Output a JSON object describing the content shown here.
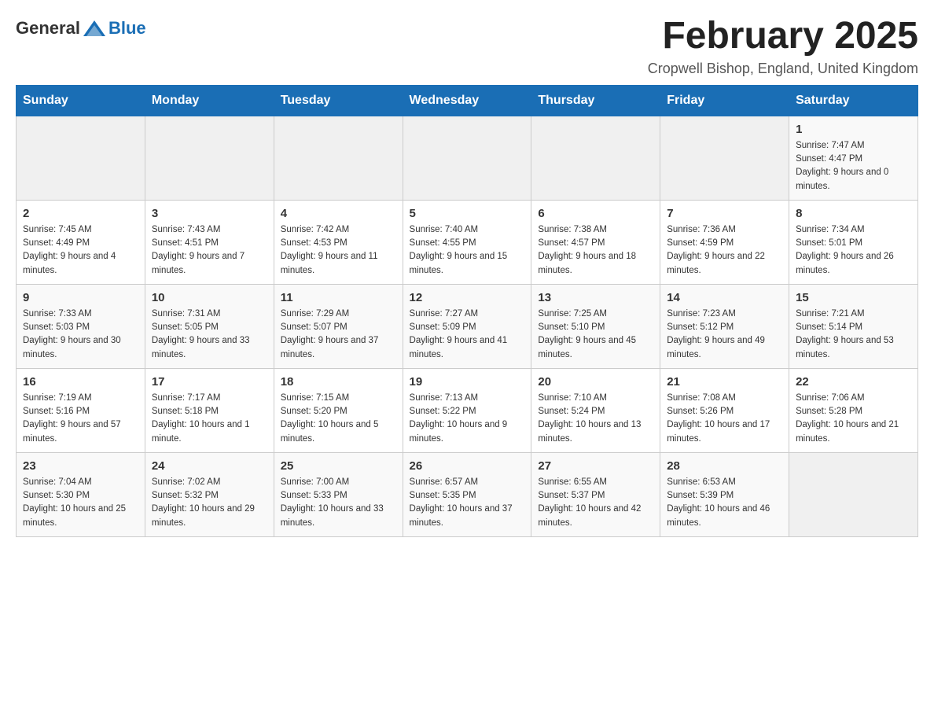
{
  "logo": {
    "general": "General",
    "blue": "Blue"
  },
  "title": "February 2025",
  "location": "Cropwell Bishop, England, United Kingdom",
  "days_header": [
    "Sunday",
    "Monday",
    "Tuesday",
    "Wednesday",
    "Thursday",
    "Friday",
    "Saturday"
  ],
  "weeks": [
    [
      {
        "day": "",
        "info": ""
      },
      {
        "day": "",
        "info": ""
      },
      {
        "day": "",
        "info": ""
      },
      {
        "day": "",
        "info": ""
      },
      {
        "day": "",
        "info": ""
      },
      {
        "day": "",
        "info": ""
      },
      {
        "day": "1",
        "info": "Sunrise: 7:47 AM\nSunset: 4:47 PM\nDaylight: 9 hours and 0 minutes."
      }
    ],
    [
      {
        "day": "2",
        "info": "Sunrise: 7:45 AM\nSunset: 4:49 PM\nDaylight: 9 hours and 4 minutes."
      },
      {
        "day": "3",
        "info": "Sunrise: 7:43 AM\nSunset: 4:51 PM\nDaylight: 9 hours and 7 minutes."
      },
      {
        "day": "4",
        "info": "Sunrise: 7:42 AM\nSunset: 4:53 PM\nDaylight: 9 hours and 11 minutes."
      },
      {
        "day": "5",
        "info": "Sunrise: 7:40 AM\nSunset: 4:55 PM\nDaylight: 9 hours and 15 minutes."
      },
      {
        "day": "6",
        "info": "Sunrise: 7:38 AM\nSunset: 4:57 PM\nDaylight: 9 hours and 18 minutes."
      },
      {
        "day": "7",
        "info": "Sunrise: 7:36 AM\nSunset: 4:59 PM\nDaylight: 9 hours and 22 minutes."
      },
      {
        "day": "8",
        "info": "Sunrise: 7:34 AM\nSunset: 5:01 PM\nDaylight: 9 hours and 26 minutes."
      }
    ],
    [
      {
        "day": "9",
        "info": "Sunrise: 7:33 AM\nSunset: 5:03 PM\nDaylight: 9 hours and 30 minutes."
      },
      {
        "day": "10",
        "info": "Sunrise: 7:31 AM\nSunset: 5:05 PM\nDaylight: 9 hours and 33 minutes."
      },
      {
        "day": "11",
        "info": "Sunrise: 7:29 AM\nSunset: 5:07 PM\nDaylight: 9 hours and 37 minutes."
      },
      {
        "day": "12",
        "info": "Sunrise: 7:27 AM\nSunset: 5:09 PM\nDaylight: 9 hours and 41 minutes."
      },
      {
        "day": "13",
        "info": "Sunrise: 7:25 AM\nSunset: 5:10 PM\nDaylight: 9 hours and 45 minutes."
      },
      {
        "day": "14",
        "info": "Sunrise: 7:23 AM\nSunset: 5:12 PM\nDaylight: 9 hours and 49 minutes."
      },
      {
        "day": "15",
        "info": "Sunrise: 7:21 AM\nSunset: 5:14 PM\nDaylight: 9 hours and 53 minutes."
      }
    ],
    [
      {
        "day": "16",
        "info": "Sunrise: 7:19 AM\nSunset: 5:16 PM\nDaylight: 9 hours and 57 minutes."
      },
      {
        "day": "17",
        "info": "Sunrise: 7:17 AM\nSunset: 5:18 PM\nDaylight: 10 hours and 1 minute."
      },
      {
        "day": "18",
        "info": "Sunrise: 7:15 AM\nSunset: 5:20 PM\nDaylight: 10 hours and 5 minutes."
      },
      {
        "day": "19",
        "info": "Sunrise: 7:13 AM\nSunset: 5:22 PM\nDaylight: 10 hours and 9 minutes."
      },
      {
        "day": "20",
        "info": "Sunrise: 7:10 AM\nSunset: 5:24 PM\nDaylight: 10 hours and 13 minutes."
      },
      {
        "day": "21",
        "info": "Sunrise: 7:08 AM\nSunset: 5:26 PM\nDaylight: 10 hours and 17 minutes."
      },
      {
        "day": "22",
        "info": "Sunrise: 7:06 AM\nSunset: 5:28 PM\nDaylight: 10 hours and 21 minutes."
      }
    ],
    [
      {
        "day": "23",
        "info": "Sunrise: 7:04 AM\nSunset: 5:30 PM\nDaylight: 10 hours and 25 minutes."
      },
      {
        "day": "24",
        "info": "Sunrise: 7:02 AM\nSunset: 5:32 PM\nDaylight: 10 hours and 29 minutes."
      },
      {
        "day": "25",
        "info": "Sunrise: 7:00 AM\nSunset: 5:33 PM\nDaylight: 10 hours and 33 minutes."
      },
      {
        "day": "26",
        "info": "Sunrise: 6:57 AM\nSunset: 5:35 PM\nDaylight: 10 hours and 37 minutes."
      },
      {
        "day": "27",
        "info": "Sunrise: 6:55 AM\nSunset: 5:37 PM\nDaylight: 10 hours and 42 minutes."
      },
      {
        "day": "28",
        "info": "Sunrise: 6:53 AM\nSunset: 5:39 PM\nDaylight: 10 hours and 46 minutes."
      },
      {
        "day": "",
        "info": ""
      }
    ]
  ]
}
